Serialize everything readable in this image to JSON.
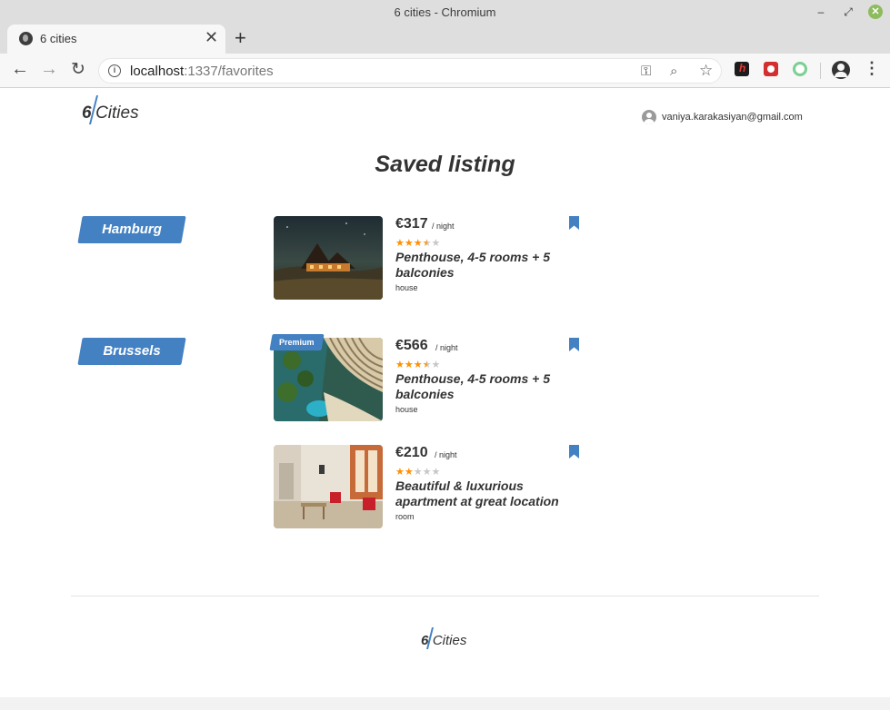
{
  "window": {
    "title": "6 cities - Chromium",
    "min_glyph": "–",
    "max_glyph": "⤢",
    "close_glyph": "✕"
  },
  "tab": {
    "title": "6 cities",
    "close_glyph": "✕",
    "new_tab_glyph": "+"
  },
  "toolbar": {
    "back_glyph": "←",
    "forward_glyph": "→",
    "reload_glyph": "↻",
    "info_glyph": "i",
    "url_host": "localhost",
    "url_rest": ":1337/favorites",
    "key_glyph": "⚿",
    "zoom_glyph": "⌕",
    "star_glyph": "☆",
    "menu_glyph": "⋮"
  },
  "header": {
    "logo_num": "6",
    "logo_word": "Cities",
    "user_email": "vaniya.karakasiyan@gmail.com"
  },
  "main": {
    "title": "Saved listing",
    "groups": [
      {
        "city": "Hamburg",
        "offers": [
          {
            "premium": false,
            "price": "€317",
            "per_night": "/ night",
            "rating": 3.5,
            "name": "Penthouse, 4-5 rooms + 5 balconies",
            "type": "house",
            "bookmarked": true,
            "photo": "house-night"
          }
        ]
      },
      {
        "city": "Brussels",
        "offers": [
          {
            "premium": true,
            "premium_label": "Premium",
            "price": "€566",
            "per_night": "/ night",
            "rating": 3.5,
            "name": "Penthouse, 4-5 rooms + 5 balconies",
            "type": "house",
            "bookmarked": true,
            "photo": "hotel-pool"
          },
          {
            "premium": false,
            "price": "€210",
            "per_night": "/ night",
            "rating": 2,
            "name": "Beautiful & luxurious apartment at great location",
            "type": "room",
            "bookmarked": true,
            "photo": "living-room"
          }
        ]
      }
    ]
  },
  "footer": {
    "logo_num": "6",
    "logo_word": "Cities"
  },
  "colors": {
    "accent": "#4481c3",
    "star": "#ff9000",
    "star_off": "#c7c7c7",
    "text": "#333333"
  },
  "icons": {
    "bookmark": "bookmark-icon",
    "avatar": "avatar-icon",
    "star": "star-icon"
  }
}
